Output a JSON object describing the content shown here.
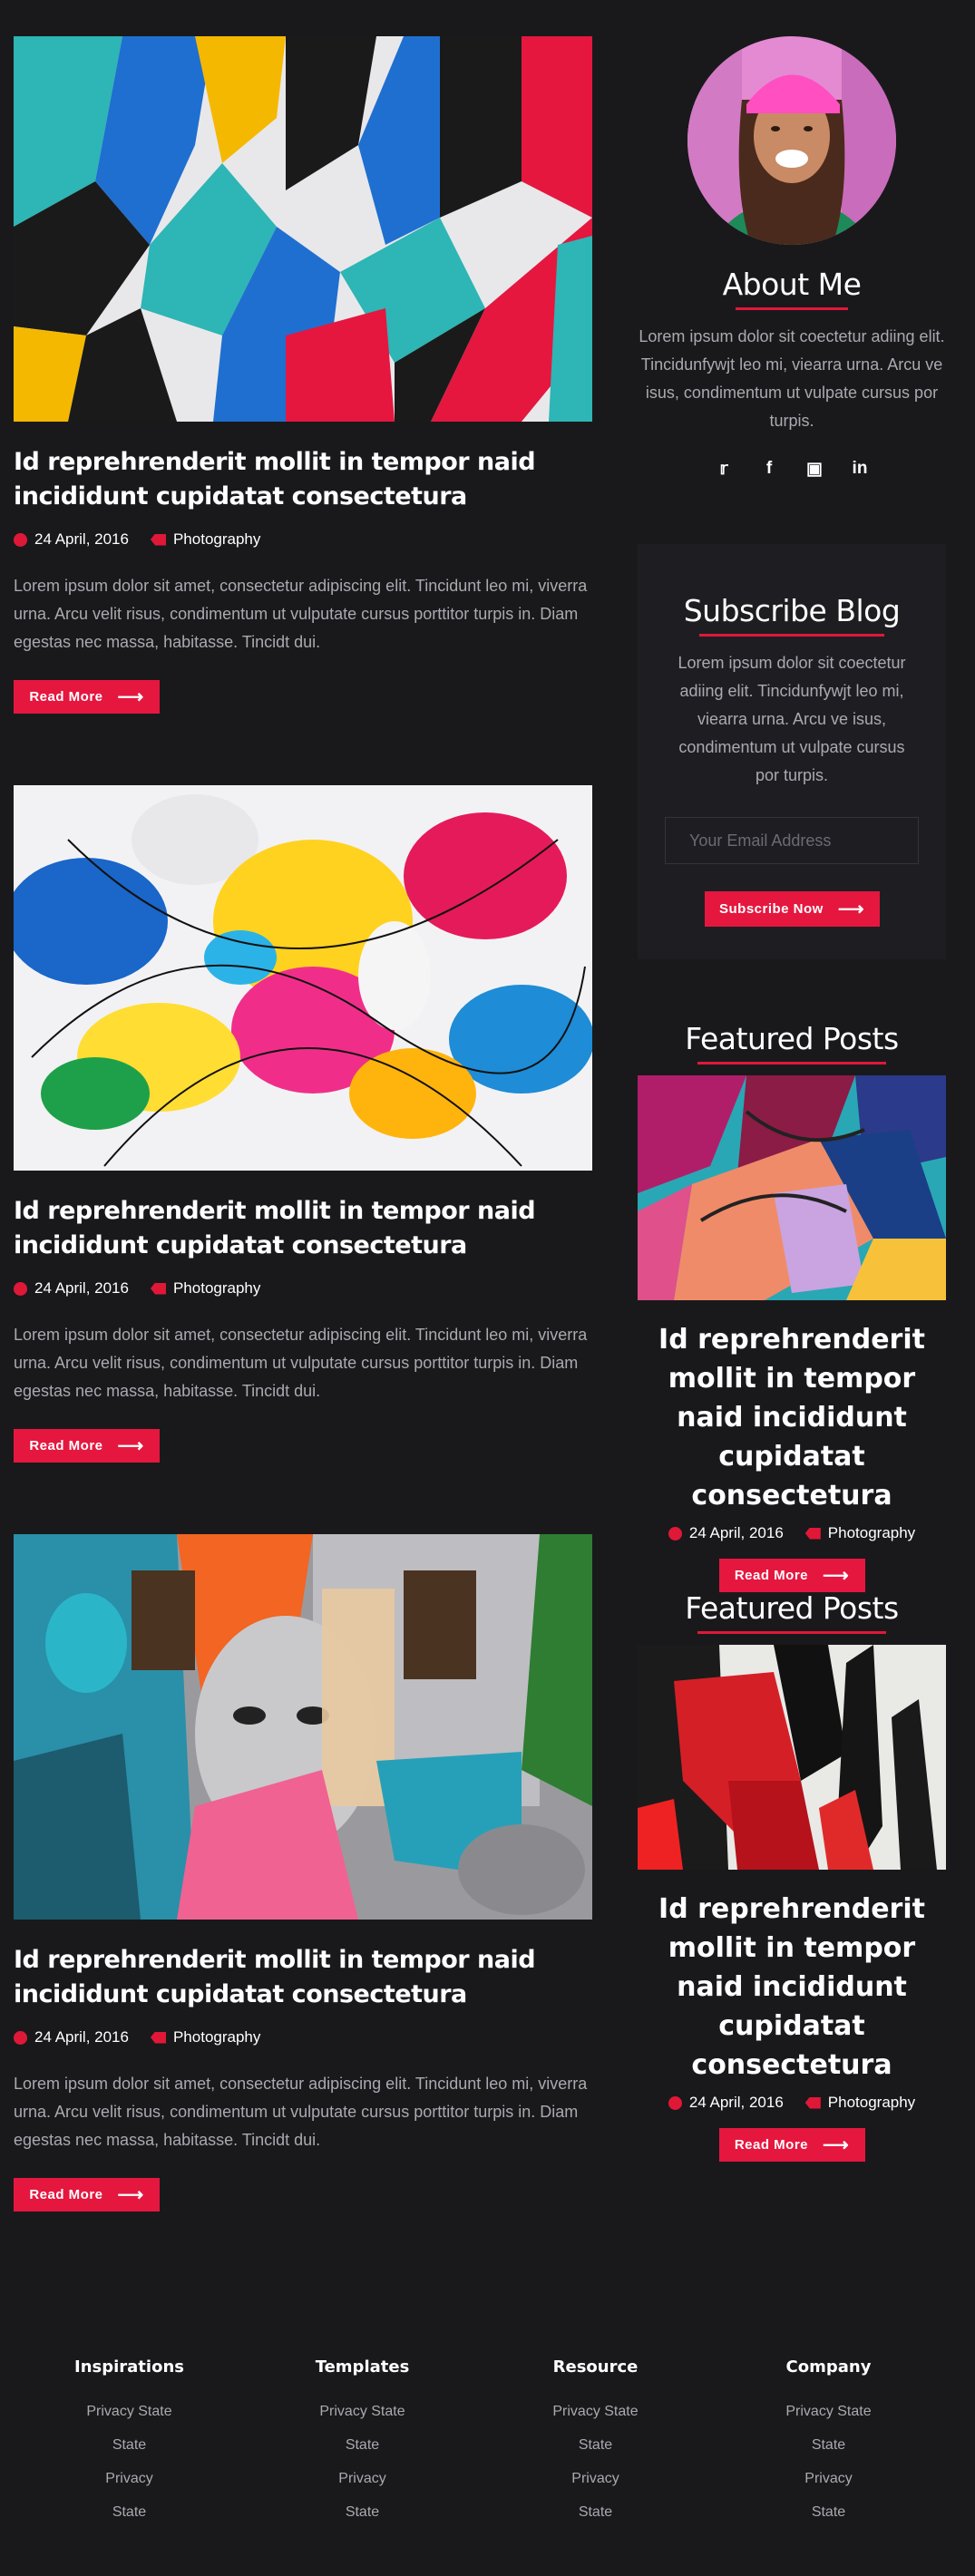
{
  "posts": [
    {
      "title": "Id reprehrenderit mollit in tempor naid incididunt cupidatat consectetura",
      "date": "24 April, 2016",
      "category": "Photography",
      "excerpt": "Lorem ipsum dolor sit amet, consectetur adipiscing elit. Tincidunt leo mi, viverra urna. Arcu velit risus, condimentum ut vulputate cursus porttitor turpis in. Diam egestas nec massa, habitasse. Tincidt dui.",
      "button": "Read More"
    },
    {
      "title": "Id reprehrenderit mollit in tempor naid incididunt cupidatat consectetura",
      "date": "24 April, 2016",
      "category": "Photography",
      "excerpt": "Lorem ipsum dolor sit amet, consectetur adipiscing elit. Tincidunt leo mi, viverra urna. Arcu velit risus, condimentum ut vulputate cursus porttitor turpis in. Diam egestas nec massa, habitasse. Tincidt dui.",
      "button": "Read More"
    },
    {
      "title": "Id reprehrenderit mollit in tempor naid incididunt cupidatat consectetura",
      "date": "24 April, 2016",
      "category": "Photography",
      "excerpt": "Lorem ipsum dolor sit amet, consectetur adipiscing elit. Tincidunt leo mi, viverra urna. Arcu velit risus, condimentum ut vulputate cursus porttitor turpis in. Diam egestas nec massa, habitasse. Tincidt dui.",
      "button": "Read More"
    }
  ],
  "about": {
    "title": "About Me",
    "text": "Lorem ipsum dolor sit coectetur adiing elit. Tincidunfywjt leo mi, viearra urna. Arcu ve isus, condimentum ut vulpate cursus por turpis.",
    "socials": [
      "twitter-icon",
      "facebook-icon",
      "instagram-icon",
      "linkedin-icon"
    ]
  },
  "subscribe": {
    "title": "Subscribe Blog",
    "text": "Lorem ipsum dolor sit coectetur adiing elit. Tincidunfywjt leo mi, viearra urna. Arcu ve isus, condimentum ut vulpate cursus por turpis.",
    "placeholder": "Your Email Address",
    "button": "Subscribe Now"
  },
  "featured": [
    {
      "heading": "Featured Posts",
      "title": "Id reprehrenderit mollit in tempor naid incididunt cupidatat consectetura",
      "date": "24 April, 2016",
      "category": "Photography",
      "button": "Read More"
    },
    {
      "heading": "Featured Posts",
      "title": "Id reprehrenderit mollit in tempor naid incididunt cupidatat consectetura",
      "date": "24 April, 2016",
      "category": "Photography",
      "button": "Read More"
    }
  ],
  "footer": [
    {
      "heading": "Inspirations",
      "links": [
        "Privacy State",
        "State",
        "Privacy",
        "State"
      ]
    },
    {
      "heading": "Templates",
      "links": [
        "Privacy State",
        "State",
        "Privacy",
        "State"
      ]
    },
    {
      "heading": "Resource",
      "links": [
        "Privacy State",
        "State",
        "Privacy",
        "State"
      ]
    },
    {
      "heading": "Company",
      "links": [
        "Privacy State",
        "State",
        "Privacy",
        "State"
      ]
    }
  ],
  "colors": {
    "accent": "#e5173f",
    "background": "#19191c",
    "text_muted": "#a9a9b0"
  }
}
